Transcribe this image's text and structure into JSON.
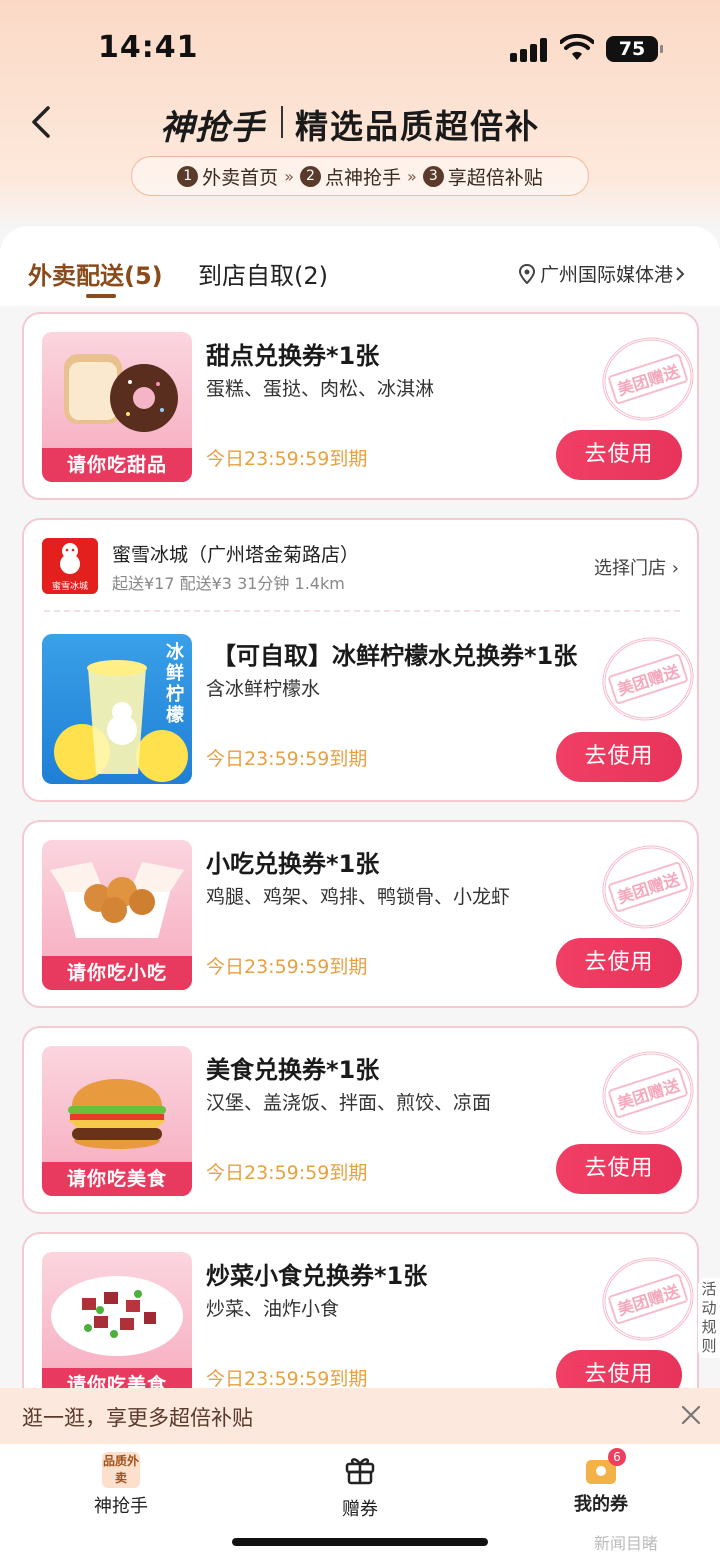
{
  "status_bar": {
    "time": "14:41",
    "battery": "75"
  },
  "header": {
    "brand": "神抢手",
    "title": "精选品质超倍补",
    "steps": [
      {
        "num": "1",
        "label": "外卖首页"
      },
      {
        "num": "2",
        "label": "点神抢手"
      },
      {
        "num": "3",
        "label": "享超倍补贴"
      }
    ]
  },
  "tabs": {
    "delivery": "外卖配送(5)",
    "pickup": "到店自取(2)",
    "location": "广州国际媒体港"
  },
  "stamp_text": "美团赠送",
  "use_label": "去使用",
  "expiry": "今日23:59:59到期",
  "shop": {
    "logo_text": "蜜雪冰城",
    "name": "蜜雪冰城（广州塔金菊路店）",
    "meta": "起送¥17  配送¥3  31分钟  1.4km",
    "choose": "选择门店"
  },
  "coupons": [
    {
      "title": "甜点兑换券*1张",
      "desc": "蛋糕、蛋挞、肉松、冰淇淋",
      "label": "请你吃甜品"
    },
    {
      "title": "【可自取】冰鲜柠檬水兑换券*1张",
      "desc": "含冰鲜柠檬水",
      "label": "冰鲜柠檬"
    },
    {
      "title": "小吃兑换券*1张",
      "desc": "鸡腿、鸡架、鸡排、鸭锁骨、小龙虾",
      "label": "请你吃小吃"
    },
    {
      "title": "美食兑换券*1张",
      "desc": "汉堡、盖浇饭、拌面、煎饺、凉面",
      "label": "请你吃美食"
    },
    {
      "title": "炒菜小食兑换券*1张",
      "desc": "炒菜、油炸小食",
      "label": "请你吃美食"
    }
  ],
  "rules": "活动规则",
  "promo": {
    "text": "逛一逛，享更多超倍补贴"
  },
  "nav": {
    "items": [
      {
        "label": "神抢手",
        "icon_text": "品质外卖"
      },
      {
        "label": "赠券"
      },
      {
        "label": "我的券",
        "badge": "6"
      }
    ]
  },
  "watermark": "新闻目睹"
}
